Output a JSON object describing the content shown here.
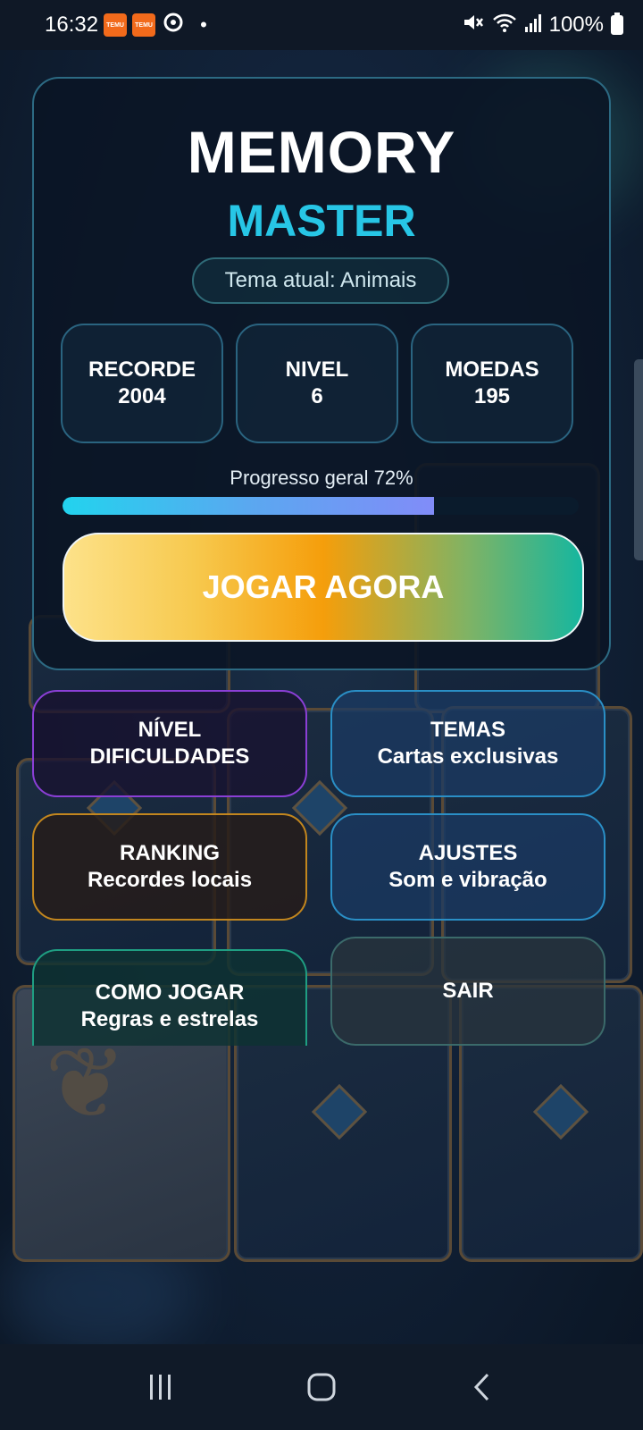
{
  "status_bar": {
    "time": "16:32",
    "battery": "100%",
    "notification_icons": [
      "temu-icon",
      "temu-icon",
      "sync-icon",
      "dot-icon"
    ],
    "right_icons": [
      "mute-icon",
      "wifi-icon",
      "signal-icon",
      "battery-icon"
    ],
    "temu_label": "TEMU"
  },
  "header": {
    "title": "MEMORY",
    "subtitle": "MASTER",
    "theme": "Tema atual: Animais"
  },
  "stats": [
    {
      "label": "RECORDE",
      "value": "2004"
    },
    {
      "label": "NIVEL",
      "value": "6"
    },
    {
      "label": "MOEDAS",
      "value": "195"
    }
  ],
  "progress": {
    "label": "Progresso geral  72%",
    "percent": 72
  },
  "play_button": "JOGAR AGORA",
  "menu": [
    {
      "title": "NÍVEL",
      "subtitle": "DIFICULDADES"
    },
    {
      "title": "TEMAS",
      "subtitle": "Cartas exclusivas"
    },
    {
      "title": "RANKING",
      "subtitle": "Recordes locais"
    },
    {
      "title": "AJUSTES",
      "subtitle": "Som e vibração"
    },
    {
      "title": "COMO JOGAR",
      "subtitle": "Regras e estrelas"
    },
    {
      "title": "SAIR",
      "subtitle": ""
    }
  ],
  "colors": {
    "accent": "#27c6e6",
    "panel_border": "#2c6a83",
    "nivel_border": "#8b3fd6",
    "ranking_border": "#c2861e",
    "como_border": "#1f9e82"
  },
  "nav_bar": {
    "icons": [
      "recents-icon",
      "home-icon",
      "back-icon"
    ]
  }
}
